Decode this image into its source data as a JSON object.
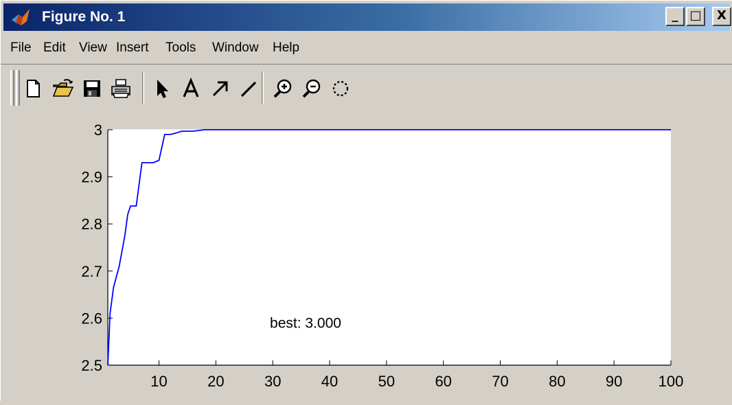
{
  "window": {
    "title": "Figure No. 1",
    "buttons": {
      "minimize": "_",
      "maximize": "□",
      "close": "X"
    }
  },
  "menu": {
    "items": [
      {
        "label": "File",
        "name": "menu-file"
      },
      {
        "label": "Edit",
        "name": "menu-edit"
      },
      {
        "label": "View",
        "name": "menu-view"
      },
      {
        "label": "Insert",
        "name": "menu-insert"
      },
      {
        "label": "Tools",
        "name": "menu-tools"
      },
      {
        "label": "Window",
        "name": "menu-window"
      },
      {
        "label": "Help",
        "name": "menu-help"
      }
    ]
  },
  "toolbar": {
    "buttons": [
      {
        "icon": "new-figure-icon"
      },
      {
        "icon": "open-file-icon"
      },
      {
        "icon": "save-icon"
      },
      {
        "icon": "print-icon"
      },
      {
        "icon": "edit-plot-arrow-icon"
      },
      {
        "icon": "insert-text-icon"
      },
      {
        "icon": "insert-arrow-icon"
      },
      {
        "icon": "insert-line-icon"
      },
      {
        "icon": "zoom-in-icon"
      },
      {
        "icon": "zoom-out-icon"
      },
      {
        "icon": "rotate-3d-icon"
      }
    ]
  },
  "colors": {
    "line": "#0000ff",
    "axes_bg": "#ffffff",
    "figure_bg": "#d4d0c8",
    "title_bar_start": "#0a246a",
    "title_bar_end": "#a6caf0"
  },
  "chart_data": {
    "type": "line",
    "title": "",
    "xlabel": "",
    "ylabel": "",
    "xlim": [
      1,
      100
    ],
    "ylim": [
      2.5,
      3.0
    ],
    "xticks": [
      10,
      20,
      30,
      40,
      50,
      60,
      70,
      80,
      90,
      100
    ],
    "yticks": [
      2.5,
      2.6,
      2.7,
      2.8,
      2.9,
      3.0
    ],
    "ytick_labels": [
      "2.5",
      "2.6",
      "2.7",
      "2.8",
      "2.9",
      "3"
    ],
    "grid": false,
    "series": [
      {
        "x": [
          1,
          1.4,
          2,
          3,
          4,
          4.5,
          5,
          6,
          7,
          8,
          9,
          10,
          11,
          12,
          13,
          14,
          16,
          18,
          20,
          100
        ],
        "y": [
          2.5,
          2.61,
          2.665,
          2.71,
          2.775,
          2.82,
          2.838,
          2.838,
          2.93,
          2.93,
          2.93,
          2.935,
          2.99,
          2.99,
          2.993,
          2.997,
          2.997,
          3.0,
          3.0,
          3.0
        ]
      }
    ],
    "annotation": {
      "text": "best: 3.000",
      "x": 29.5,
      "y": 2.59
    }
  }
}
